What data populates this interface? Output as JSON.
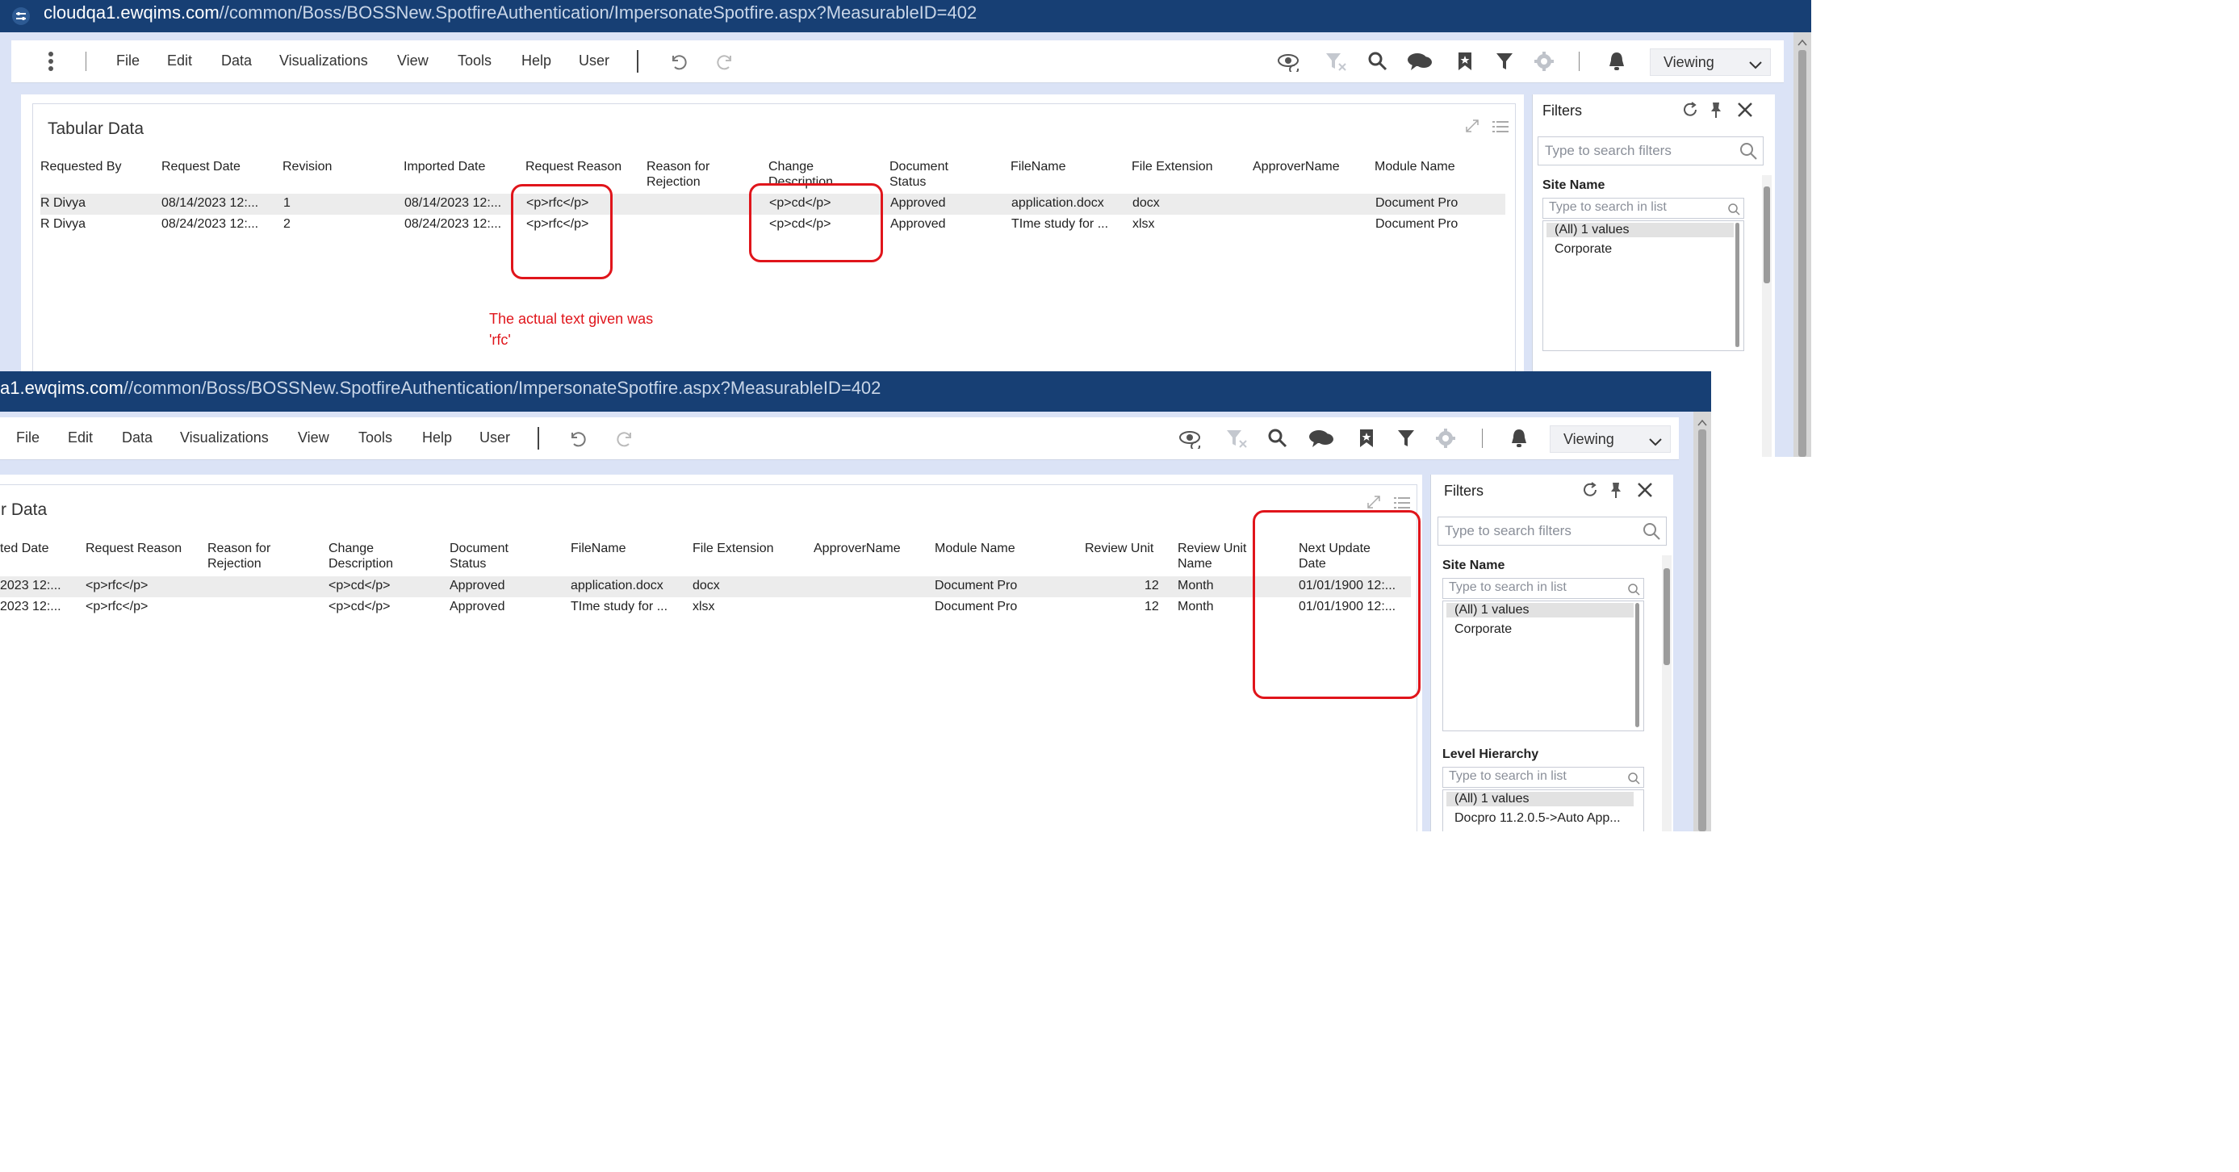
{
  "top": {
    "url_host": "cloudqa1.ewqims.com",
    "url_path": "//common/Boss/BOSSNew.SpotfireAuthentication/ImpersonateSpotfire.aspx?MeasurableID=402",
    "menu": [
      "File",
      "Edit",
      "Data",
      "Visualizations",
      "View",
      "Tools",
      "Help",
      "User"
    ],
    "viewing_label": "Viewing",
    "panel_title": "Tabular Data",
    "headers": [
      "Requested By",
      "Request Date",
      "Revision",
      "Imported Date",
      "Request Reason",
      "Reason for\nRejection",
      "Change\nDescription",
      "Document\nStatus",
      "FileName",
      "File Extension",
      "ApproverName",
      "Module Name"
    ],
    "rows": [
      [
        "R Divya",
        "08/14/2023 12:...",
        "1",
        "08/14/2023 12:...",
        "<p>rfc</p>",
        "",
        "<p>cd</p>",
        "Approved",
        "application.docx",
        "docx",
        "",
        "Document Pro"
      ],
      [
        "R Divya",
        "08/24/2023 12:...",
        "2",
        "08/24/2023 12:...",
        "<p>rfc</p>",
        "",
        "<p>cd</p>",
        "Approved",
        "TIme study for ...",
        "xlsx",
        "",
        "Document Pro"
      ]
    ],
    "annotation_line1": "The actual text given was",
    "annotation_line2": "'rfc'",
    "filters": {
      "title": "Filters",
      "search_placeholder": "Type to search filters",
      "site_name": "Site Name",
      "list_placeholder": "Type to search in list",
      "items": [
        "(All) 1 values",
        "Corporate"
      ]
    }
  },
  "bottom": {
    "url_host": "a1.ewqims.com",
    "url_path": "//common/Boss/BOSSNew.SpotfireAuthentication/ImpersonateSpotfire.aspx?MeasurableID=402",
    "menu": [
      "File",
      "Edit",
      "Data",
      "Visualizations",
      "View",
      "Tools",
      "Help",
      "User"
    ],
    "viewing_label": "Viewing",
    "panel_title": "r Data",
    "headers": [
      "ted Date",
      "Request Reason",
      "Reason for\nRejection",
      "Change\nDescription",
      "Document\nStatus",
      "FileName",
      "File Extension",
      "ApproverName",
      "Module Name",
      "Review Unit",
      "Review Unit\nName",
      "Next Update\nDate"
    ],
    "rows": [
      [
        "2023 12:...",
        "<p>rfc</p>",
        "",
        "<p>cd</p>",
        "Approved",
        "application.docx",
        "docx",
        "",
        "Document Pro",
        "12",
        "Month",
        "01/01/1900 12:..."
      ],
      [
        "2023 12:...",
        "<p>rfc</p>",
        "",
        "<p>cd</p>",
        "Approved",
        "TIme study for ...",
        "xlsx",
        "",
        "Document Pro",
        "12",
        "Month",
        "01/01/1900 12:..."
      ]
    ],
    "filters": {
      "title": "Filters",
      "search_placeholder": "Type to search filters",
      "site_name": "Site Name",
      "list_placeholder": "Type to search in list",
      "site_items": [
        "(All) 1 values",
        "Corporate"
      ],
      "level_hierarchy": "Level Hierarchy",
      "level_items": [
        "(All) 1 values",
        "Docpro 11.2.0.5->Auto App..."
      ]
    }
  },
  "colors": {
    "url_bar": "#173f74",
    "frame": "#dbe3f6",
    "callout": "#e0151b"
  }
}
